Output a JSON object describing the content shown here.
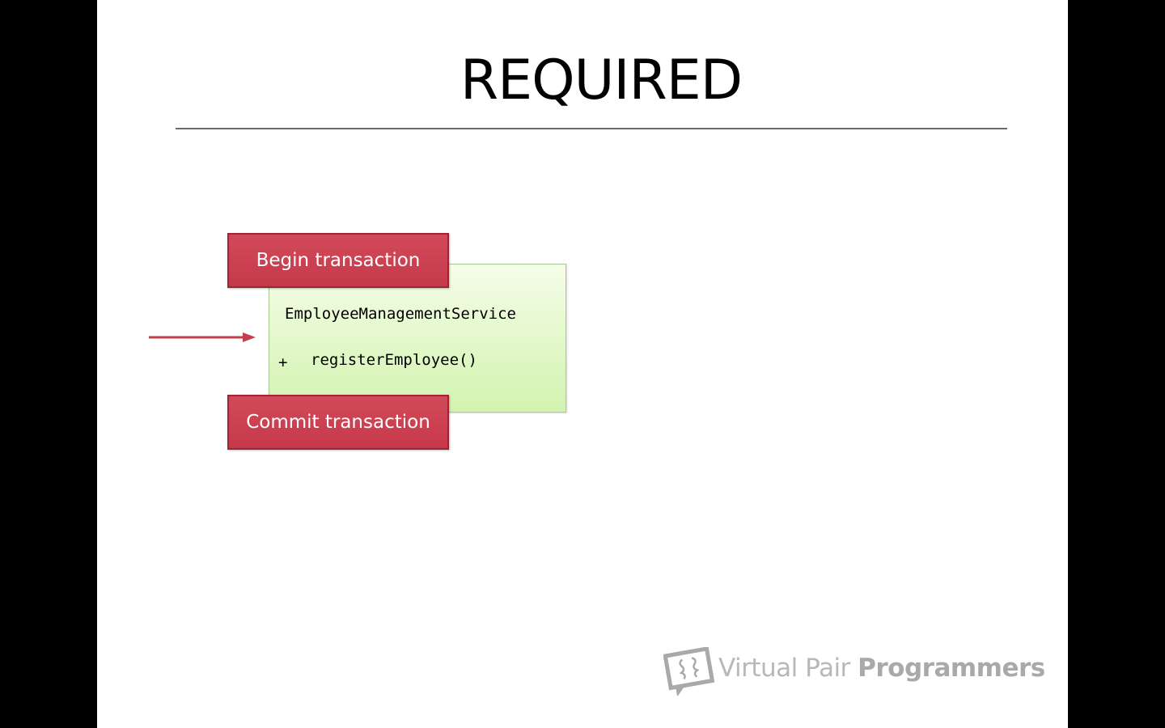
{
  "slide": {
    "title": "REQUIRED"
  },
  "diagram": {
    "begin_label": "Begin transaction",
    "service_name": "EmployeeManagementService",
    "method_visibility": "+",
    "method_name": "registerEmployee()",
    "commit_label": "Commit transaction"
  },
  "branding": {
    "logo_part1": "Virtual Pair ",
    "logo_part2": "Programmers"
  },
  "colors": {
    "transaction_red": "#c6394a",
    "service_green": "#d3f3b1",
    "arrow_red": "#c0404e",
    "background": "#000000"
  }
}
